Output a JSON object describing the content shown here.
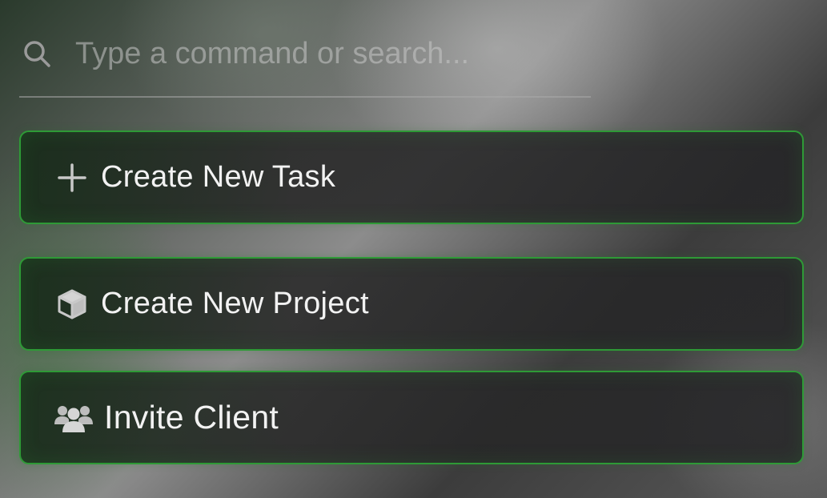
{
  "search": {
    "placeholder": "Type a command or search..."
  },
  "commands": [
    {
      "label": "Create New Task",
      "icon": "plus-icon"
    },
    {
      "label": "Create New Project",
      "icon": "cube-icon"
    },
    {
      "label": "Invite Client",
      "icon": "users-icon"
    }
  ],
  "colors": {
    "accent_border": "#2e9a36",
    "text_primary": "#f2f2f2",
    "text_placeholder": "#9a9a9a"
  }
}
